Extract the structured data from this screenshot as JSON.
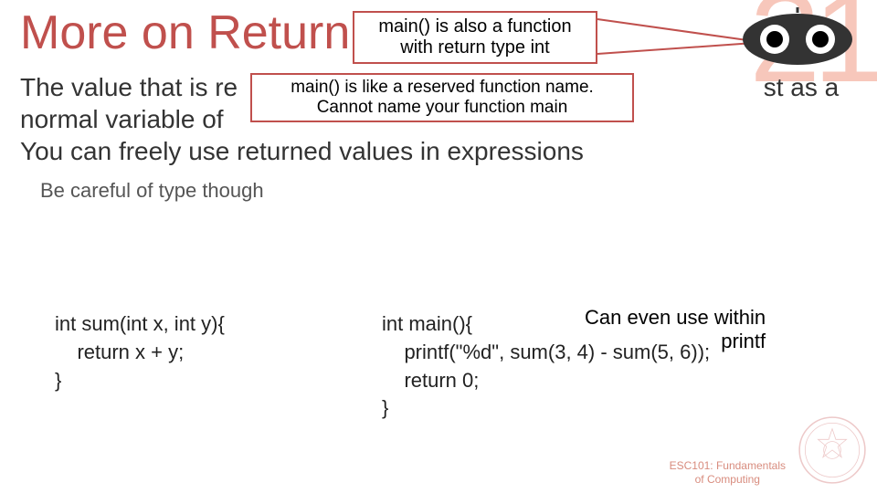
{
  "bg_number": "21",
  "title": "More on Return",
  "callout1": {
    "l1": "main() is also a function",
    "l2": "with return type int"
  },
  "callout2": {
    "l1": "main() is like a reserved function name.",
    "l2": "Cannot name your function main"
  },
  "body": {
    "l1": "The value that is re",
    "l1b": "st as a",
    "l2": "normal variable of",
    "l3": "You can freely use returned values in expressions"
  },
  "sub": "Be careful of type though",
  "code_left": "int sum(int x, int y){\n    return x + y;\n}",
  "code_right": "int main(){\n    printf(\"%d\", sum(3, 4) - sum(5, 6));\n    return 0;\n}",
  "callout3": {
    "l1": "Can even use within",
    "l2": "printf"
  },
  "footer": {
    "l1": "ESC101: Fundamentals",
    "l2": "of Computing"
  }
}
